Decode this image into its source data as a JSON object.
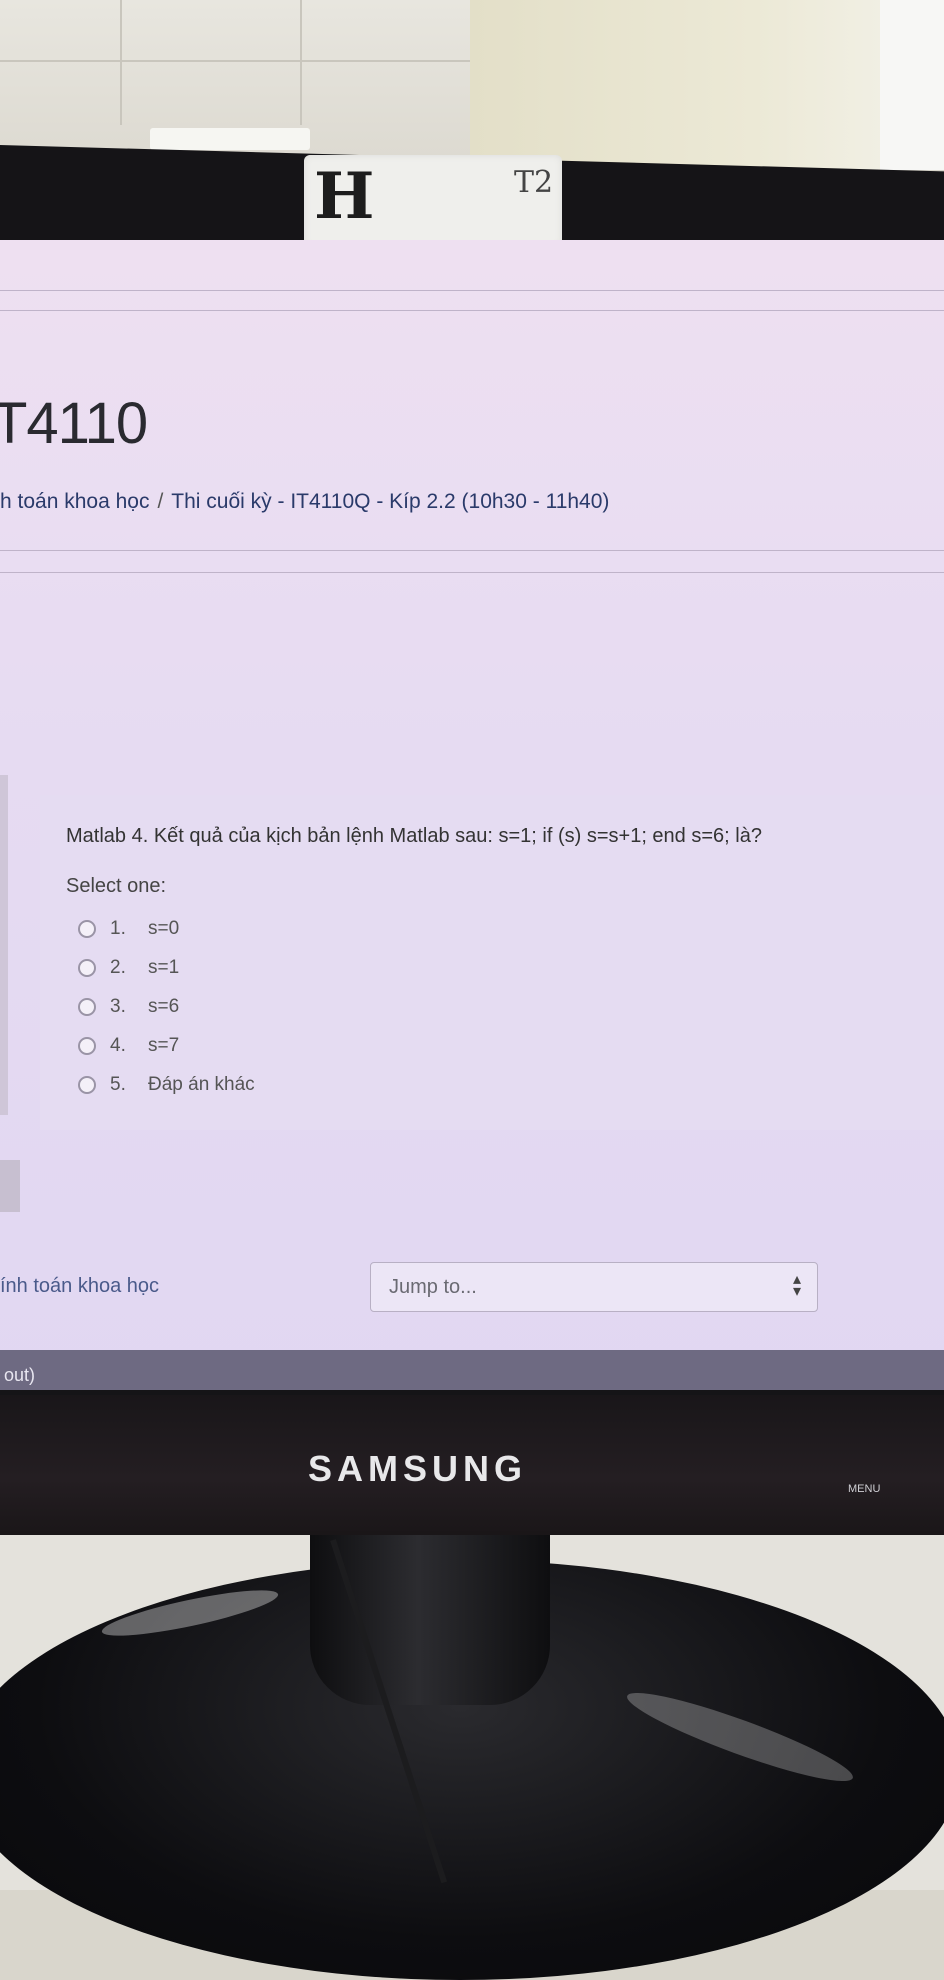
{
  "sticker": {
    "mark": "H",
    "note": "T2"
  },
  "course": {
    "code_fragment": "T4110",
    "breadcrumb": [
      "h toán khoa học",
      "Thi cuối kỳ - IT4110Q - Kíp 2.2 (10h30 - 11h40)"
    ],
    "breadcrumb_separator": "/"
  },
  "question": {
    "text": "Matlab 4. Kết quả của kịch bản lệnh Matlab sau: s=1; if (s) s=s+1; end s=6; là?",
    "select_label": "Select one:",
    "options": [
      {
        "number": "1.",
        "label": "s=0"
      },
      {
        "number": "2.",
        "label": "s=1"
      },
      {
        "number": "3.",
        "label": "s=6"
      },
      {
        "number": "4.",
        "label": "s=7"
      },
      {
        "number": "5.",
        "label": "Đáp án khác"
      }
    ]
  },
  "footer": {
    "course_link": "ính toán khoa học",
    "jump_placeholder": "Jump to...",
    "logout_fragment": "out)"
  },
  "monitor": {
    "brand": "SAMSUNG",
    "menu_label": "MENU"
  }
}
